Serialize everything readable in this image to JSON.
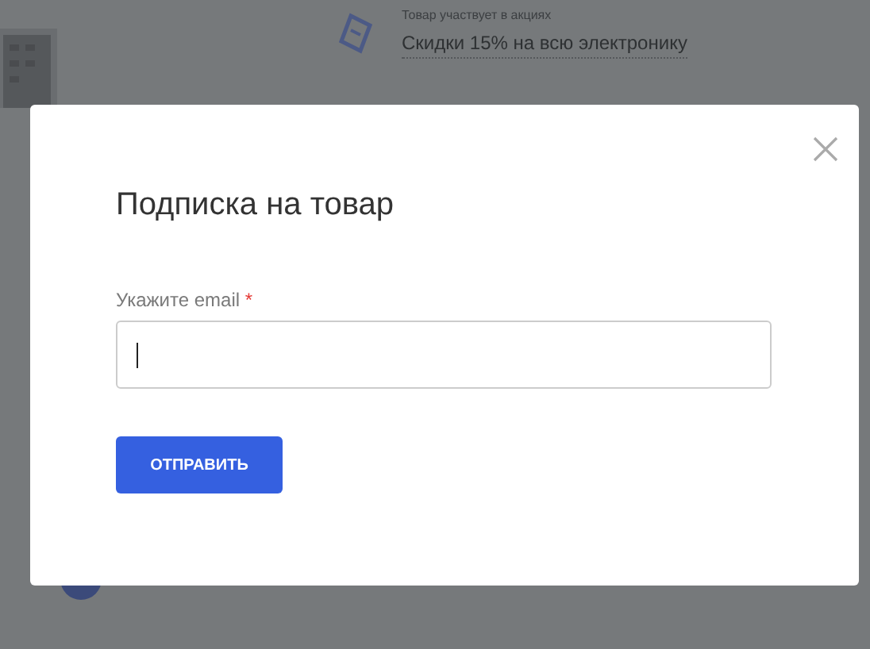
{
  "background": {
    "promo_caption": "Товар участвует в акциях",
    "promo_title": "Скидки 15% на всю электронику"
  },
  "modal": {
    "title": "Подписка на товар",
    "field": {
      "label": "Укажите email",
      "required_mark": "*",
      "focused": true
    },
    "submit_button": "ОТПРАВИТЬ"
  }
}
